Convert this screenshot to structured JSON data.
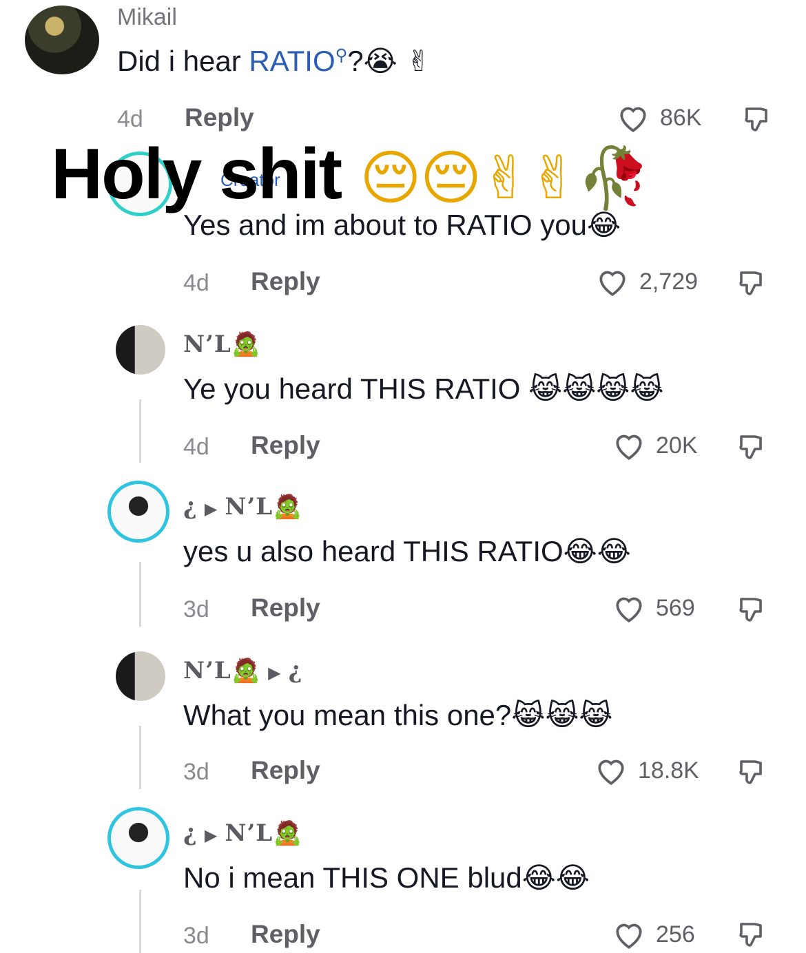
{
  "comments": [
    {
      "username": "Mikail",
      "text_pre": "Did i hear ",
      "text_link": "RATIO",
      "text_post": "?",
      "emoji": "😭 ✌",
      "age": "4d",
      "reply_label": "Reply",
      "likes": "86K"
    },
    {
      "creator_tag": "Creator",
      "text": "Yes and im about to RATIO you",
      "emoji": "😂",
      "age": "4d",
      "reply_label": "Reply",
      "likes": "2,729"
    },
    {
      "username": "N’L",
      "username_emoji": "🧟",
      "text": "Ye you heard THIS RATIO",
      "emoji": "😹😹😹😹",
      "age": "4d",
      "reply_label": "Reply",
      "likes": "20K"
    },
    {
      "username": "¿",
      "reply_to": "N’L",
      "reply_to_emoji": "🧟",
      "text": "yes u also heard THIS RATIO",
      "emoji": "😂😂",
      "age": "3d",
      "reply_label": "Reply",
      "likes": "569"
    },
    {
      "username": "N’L",
      "username_emoji": "🧟",
      "reply_to": "¿",
      "text": "What you mean this one?",
      "emoji": "😹😹😹",
      "age": "3d",
      "reply_label": "Reply",
      "likes": "18.8K"
    },
    {
      "username": "¿",
      "reply_to": "N’L",
      "reply_to_emoji": "🧟",
      "text": "No i mean THIS ONE blud",
      "emoji": "😂😂",
      "age": "3d",
      "reply_label": "Reply",
      "likes": "256"
    }
  ],
  "overlay": {
    "text": "Holy shit",
    "emoji": "😔😔✌✌🥀"
  },
  "colors": {
    "link": "#2b5db5",
    "text": "#161823",
    "muted": "#8a8b91",
    "ring": "#2fc4e0"
  },
  "icons": [
    "heart-icon",
    "dislike-icon"
  ]
}
